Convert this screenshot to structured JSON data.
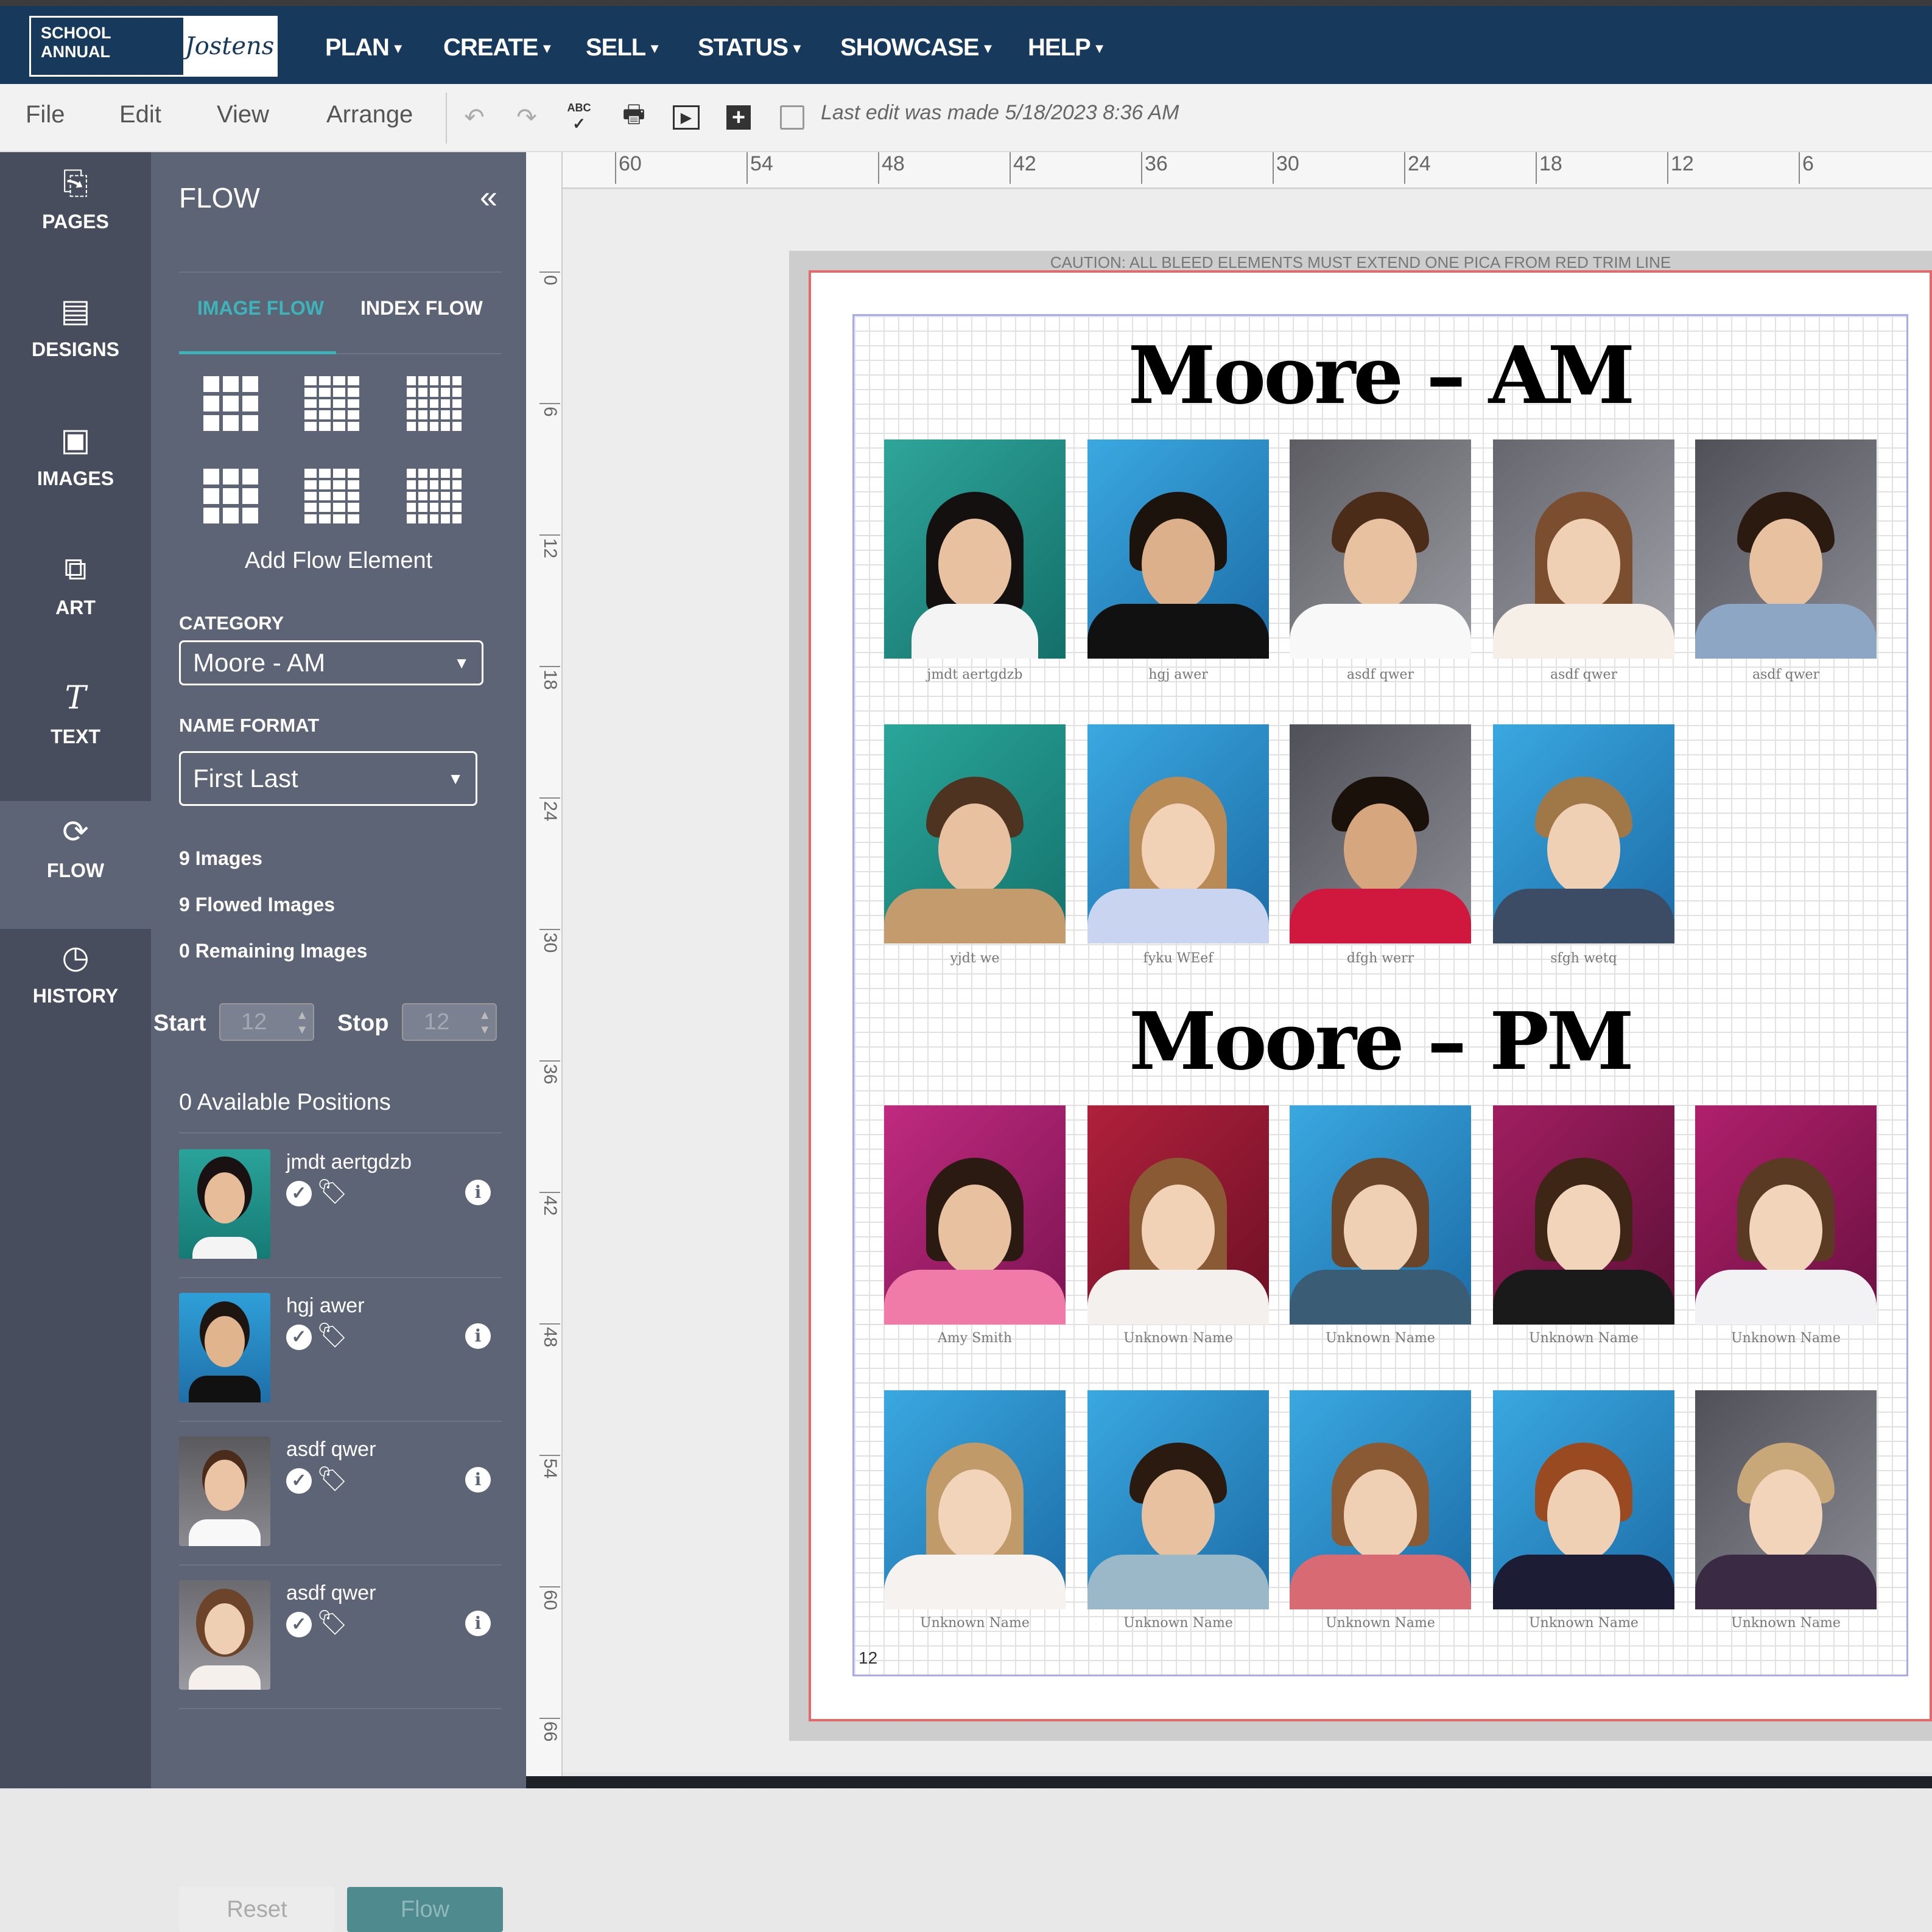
{
  "logo": {
    "left": "SCHOOL ANNUAL",
    "right": "Jostens"
  },
  "nav": [
    {
      "label": "PLAN"
    },
    {
      "label": "CREATE"
    },
    {
      "label": "SELL"
    },
    {
      "label": "STATUS"
    },
    {
      "label": "SHOWCASE"
    },
    {
      "label": "HELP"
    }
  ],
  "menu": {
    "file": "File",
    "edit": "Edit",
    "view": "View",
    "arrange": "Arrange",
    "last_edit": "Last edit was made 5/18/2023 8:36 AM",
    "spell_icon": "ABC"
  },
  "rail": [
    {
      "label": "PAGES",
      "icon": "pages-icon"
    },
    {
      "label": "DESIGNS",
      "icon": "designs-icon"
    },
    {
      "label": "IMAGES",
      "icon": "images-icon"
    },
    {
      "label": "ART",
      "icon": "art-icon"
    },
    {
      "label": "TEXT",
      "icon": "text-icon"
    },
    {
      "label": "FLOW",
      "icon": "flow-icon"
    },
    {
      "label": "HISTORY",
      "icon": "history-icon"
    }
  ],
  "panel": {
    "title": "FLOW",
    "tabs": [
      "IMAGE FLOW",
      "INDEX FLOW"
    ],
    "add_flow": "Add Flow Element",
    "category_label": "CATEGORY",
    "category_value": "Moore - AM",
    "name_format_label": "NAME FORMAT",
    "name_format_value": "First Last",
    "images": "9 Images",
    "flowed": "9 Flowed Images",
    "remaining": "0 Remaining Images",
    "start_label": "Start",
    "start_value": "12",
    "stop_label": "Stop",
    "stop_value": "12",
    "available": "0 Available Positions",
    "list": [
      {
        "name": "jmdt aertgdzb"
      },
      {
        "name": "hgj awer"
      },
      {
        "name": "asdf qwer"
      },
      {
        "name": "asdf qwer"
      }
    ],
    "reset": "Reset",
    "flow": "Flow"
  },
  "ruler": {
    "h": [
      "60",
      "54",
      "48",
      "42",
      "36",
      "30",
      "24",
      "18",
      "12",
      "6"
    ],
    "v": [
      "0",
      "6",
      "12",
      "18",
      "24",
      "30",
      "36",
      "42",
      "48",
      "54",
      "60",
      "66"
    ]
  },
  "page": {
    "caution": "CAUTION: ALL BLEED ELEMENTS MUST EXTEND ONE PICA FROM RED TRIM LINE",
    "heading_am": "Moore – AM",
    "heading_pm": "Moore – PM",
    "page_number": "12",
    "am_names": [
      "jmdt aertgdzb",
      "hgj awer",
      "asdf qwer",
      "asdf qwer",
      "asdf qwer",
      "yjdt we",
      "fyku WEef",
      "dfgh werr",
      "sfgh wetq"
    ],
    "pm_names": [
      "Amy Smith",
      "Unknown Name",
      "Unknown Name",
      "Unknown Name",
      "Unknown Name",
      "Unknown Name",
      "Unknown Name",
      "Unknown Name",
      "Unknown Name",
      "Unknown Name"
    ]
  },
  "colors": {
    "nav_bg": "#173a5c",
    "panel_bg": "#5d6476",
    "rail_bg": "#474d5c",
    "accent": "#3db4b9",
    "flow_button": "#4f8a8f",
    "trim_red": "#e36a6a",
    "safe_blue": "#a9a9ee"
  }
}
